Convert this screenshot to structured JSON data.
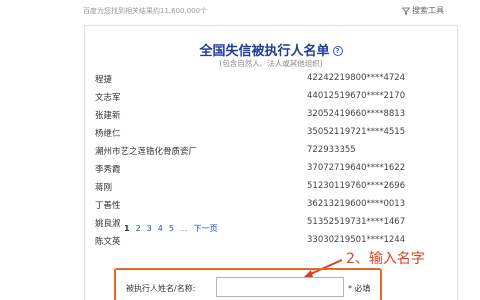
{
  "header": {
    "result_count": "百度为您找到相关结果约11,600,000个",
    "search_tools": "搜索工具"
  },
  "card": {
    "title": "全国失信被执行人名单",
    "subtitle": "(包含自然人、法人或其他组织)",
    "rows": [
      {
        "name": "程捷",
        "id": "42242219800****4724"
      },
      {
        "name": "文志军",
        "id": "44012519670****2170"
      },
      {
        "name": "张建新",
        "id": "32052419660****8813"
      },
      {
        "name": "杨继仁",
        "id": "35052119721****4515"
      },
      {
        "name": "潮州市艺之莲锆化骨质瓷厂",
        "id": "722933355"
      },
      {
        "name": "李秀霞",
        "id": "37072719640****1622"
      },
      {
        "name": "蒋刚",
        "id": "51230119760****2696"
      },
      {
        "name": "丁善性",
        "id": "36213219600****0013"
      },
      {
        "name": "姚良淑",
        "id": "51352519731****1467"
      },
      {
        "name": "陈文英",
        "id": "33030219501****1244"
      }
    ]
  },
  "pagination": {
    "pages": [
      "1",
      "2",
      "3",
      "4",
      "5"
    ],
    "current": "1",
    "ellipsis": "...",
    "next": "下一页"
  },
  "annotation": {
    "text": "2、输入名字",
    "color": "#e0401e"
  },
  "search_form": {
    "label": "被执行人姓名/名称:",
    "value": "",
    "placeholder": "",
    "required": "* 必填"
  },
  "colors": {
    "title": "#1e3c9e",
    "link": "#1e50b4",
    "highlight_box": "#e06a2b"
  }
}
